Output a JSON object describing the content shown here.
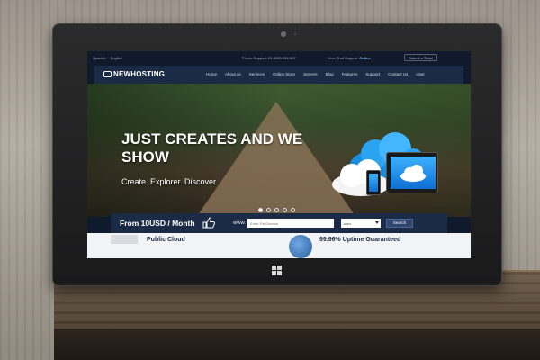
{
  "topbar": {
    "languages": [
      "Spanish",
      "English"
    ],
    "phone_support": "Phone Support: 01-8000-634-567",
    "live_chat_label": "Live Chat Support:",
    "live_chat_status": "Online",
    "ticket_button": "Submit a Ticket"
  },
  "navbar": {
    "logo": "NEWHOSTING",
    "items": [
      "Home",
      "About us",
      "Services",
      "Online Store",
      "Servers",
      "Blog",
      "Features",
      "Support",
      "Contact Us",
      "User"
    ]
  },
  "hero": {
    "title": "JUST CREATES AND WE SHOW",
    "subtitle": "Create. Explorer. Discover",
    "slides_total": 5,
    "active_slide": 1
  },
  "search": {
    "price_text": "From 10USD / Month",
    "www_label": "WWW.",
    "domain_placeholder": "Enter Fst Domain",
    "tld_selected": ".com",
    "search_button": "Search"
  },
  "content": {
    "left_heading": "Public Cloud",
    "right_heading": "99.96% Uptime Guaranteed"
  },
  "colors": {
    "navbar_bg": "#1c2b45",
    "accent_blue": "#3db1ff"
  }
}
